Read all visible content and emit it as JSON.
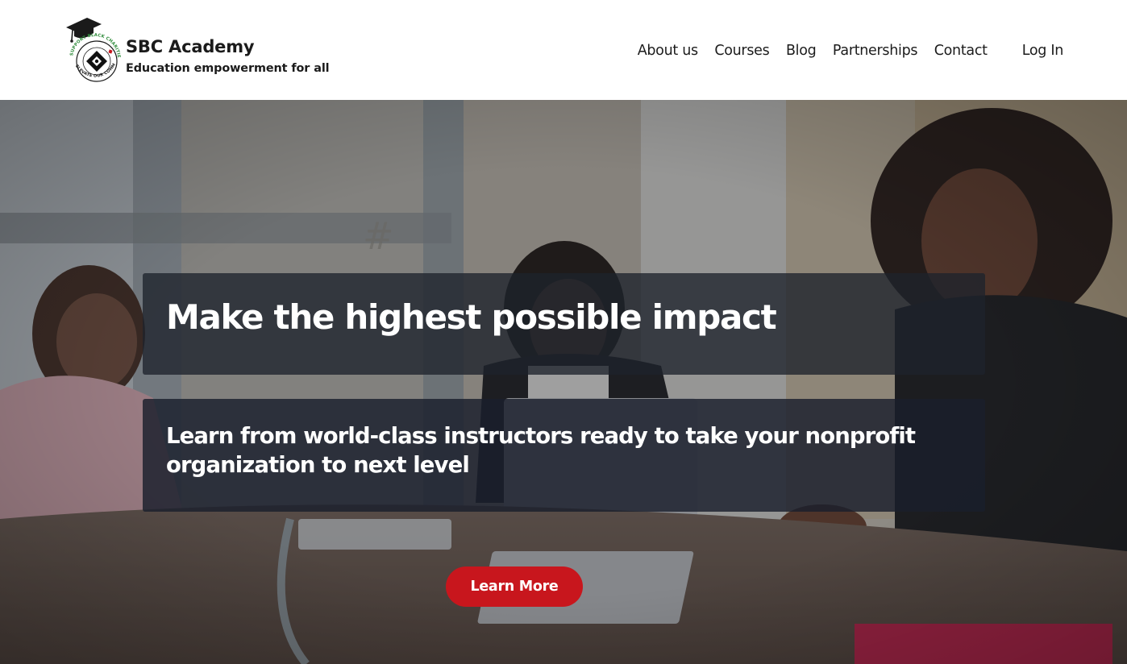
{
  "brand": {
    "name": "SBC Academy",
    "tagline": "Education empowerment for all",
    "emblem_icon": "graduation-cap-diamond-seal",
    "emblem_ring_top": "SUPPORT BLACK CHARITIES",
    "emblem_ring_bottom": "ELEVATE OUR COMMUNITY"
  },
  "nav": {
    "items": [
      {
        "label": "About us"
      },
      {
        "label": "Courses"
      },
      {
        "label": "Blog"
      },
      {
        "label": "Partnerships"
      },
      {
        "label": "Contact"
      }
    ],
    "login_label": "Log In"
  },
  "hero": {
    "background_image": "women-meeting-around-conference-table-photo",
    "headline": "Make the highest possible impact",
    "subheadline": "Learn from world-class instructors ready to take your nonprofit organization to next level",
    "cta_label": "Learn More"
  },
  "colors": {
    "accent": "#c8161d",
    "header_bg": "#ffffff",
    "overlay": "#1e222c",
    "nav_text": "#1c1c1c"
  }
}
